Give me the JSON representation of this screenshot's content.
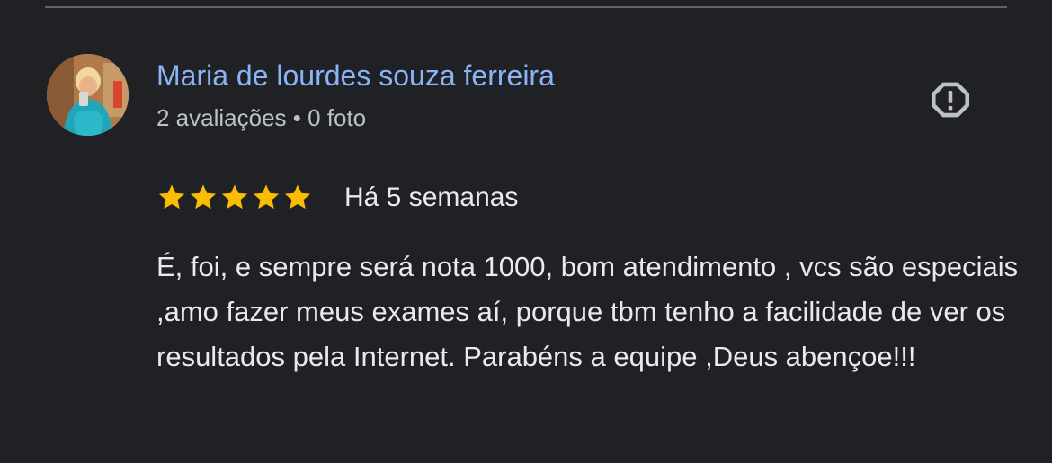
{
  "review": {
    "reviewer_name": "Maria de lourdes souza ferreira",
    "reviewer_meta": "2 avaliações • 0 foto",
    "rating": 5,
    "rating_max": 5,
    "date": "Há 5 semanas",
    "text": "É, foi, e sempre será nota 1000, bom atendimento , vcs são especiais ,amo fazer meus exames aí, porque tbm tenho a facilidade de ver os resultados pela Internet. Parabéns a equipe ,Deus abençoe!!!"
  },
  "icons": {
    "report": "report-flag-icon",
    "star": "star-icon",
    "avatar": "avatar-photo"
  },
  "colors": {
    "background": "#202124",
    "name_link": "#8ab4f8",
    "star": "#fbbc04",
    "text": "#e8eaed",
    "secondary_text": "#bdc1c6",
    "icon": "#bdc1c6"
  }
}
